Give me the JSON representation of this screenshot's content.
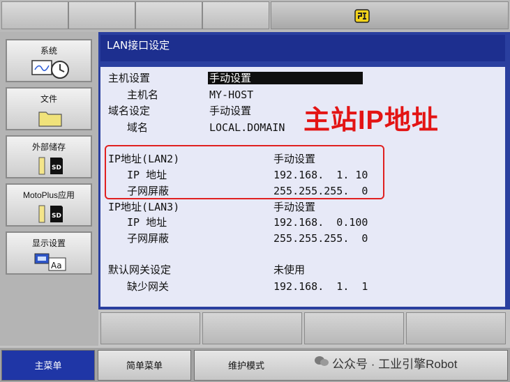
{
  "window": {
    "title": "LAN接口设定"
  },
  "left_menu": [
    {
      "label": "系统",
      "icon": "system-clock-icon"
    },
    {
      "label": "文件",
      "icon": "folder-icon"
    },
    {
      "label": "外部储存",
      "icon": "sd-card-icon"
    },
    {
      "label": "MotoPlus应用",
      "icon": "sd-card-icon"
    },
    {
      "label": "显示设置",
      "icon": "display-font-icon"
    }
  ],
  "settings": {
    "host": {
      "label": "主机设置",
      "value": "手动设置",
      "name_label": "主机名",
      "name_value": "MY-HOST"
    },
    "domain": {
      "label": "域名设定",
      "value": "手动设置",
      "name_label": "域名",
      "name_value": "LOCAL.DOMAIN"
    },
    "lan2": {
      "label": "IP地址(LAN2)",
      "value": "手动设置",
      "ip_label": "IP 地址",
      "ip_value": "192.168.  1. 10",
      "mask_label": "子网屏蔽",
      "mask_value": "255.255.255.  0"
    },
    "lan3": {
      "label": "IP地址(LAN3)",
      "value": "手动设置",
      "ip_label": "IP 地址",
      "ip_value": "192.168.  0.100",
      "mask_label": "子网屏蔽",
      "mask_value": "255.255.255.  0"
    },
    "gateway": {
      "label": "默认网关设定",
      "value": "未使用",
      "sub_label": "缺少网关",
      "sub_value": "192.168.  1.  1"
    }
  },
  "annotation": {
    "text": "主站IP地址",
    "color": "#e31414"
  },
  "bottom_menu": {
    "main": "主菜单",
    "simple": "简单菜单",
    "maintenance": "维护模式"
  },
  "watermark": "公众号 · 工业引擎Robot",
  "colors": {
    "title_bar": "#1d2f8f",
    "content_bg": "#e7e9f7",
    "active_tab": "#1f36a6"
  }
}
